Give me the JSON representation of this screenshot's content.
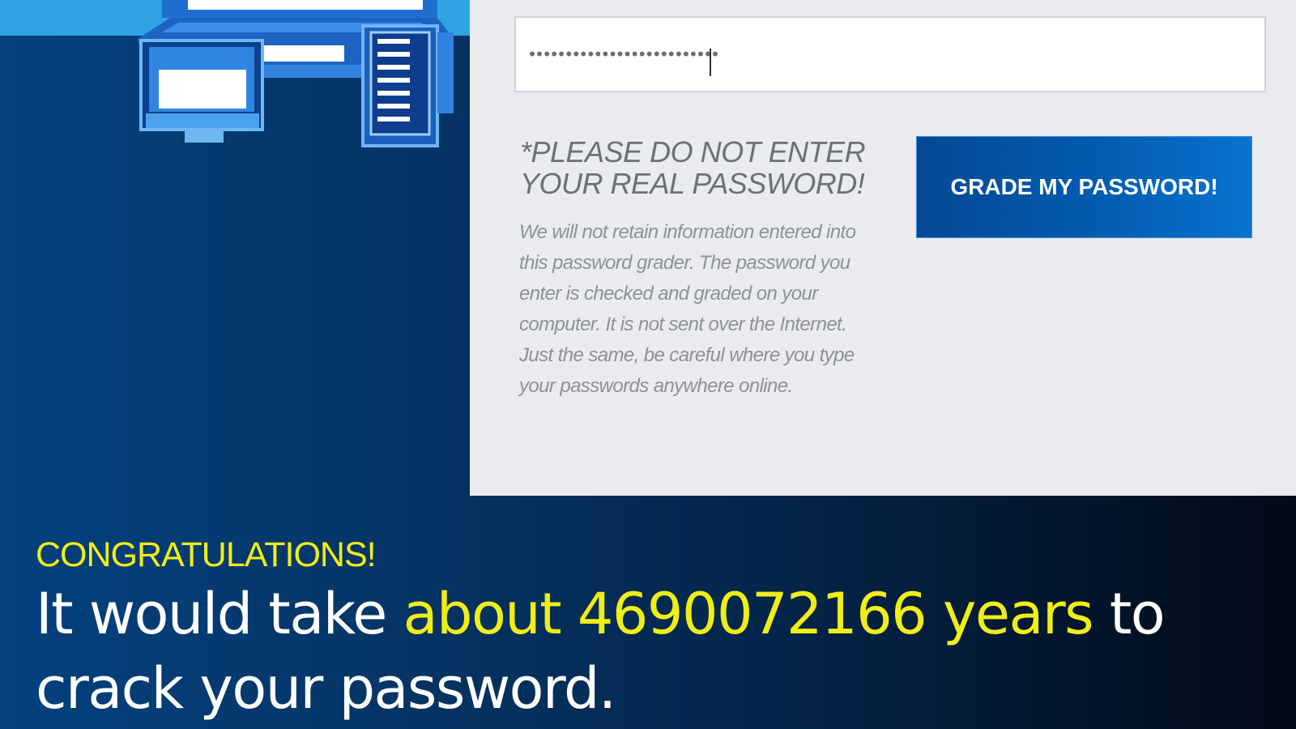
{
  "password_field": {
    "value": "••••••••••••••••••••••••••"
  },
  "warning": {
    "line1": "*PLEASE DO NOT ENTER",
    "line2": "YOUR REAL PASSWORD!"
  },
  "disclaimer": {
    "text": "We will not retain information entered into this password grader. The password you enter is checked and graded on your computer. It is not sent over the Internet. Just the same, be careful where you type your passwords anywhere online."
  },
  "grade_button": {
    "label": "GRADE MY PASSWORD!"
  },
  "result": {
    "heading": "CONGRATULATIONS!",
    "prefix": "It would take ",
    "highlight": "about 4690072166 years",
    "suffix": " to crack your password."
  },
  "colors": {
    "highlight": "#f1ee14",
    "button": "#045cb0",
    "panel": "#e9ebef"
  },
  "icons": [
    "laptop-icon",
    "monitor-icon",
    "server-rack-icon"
  ]
}
